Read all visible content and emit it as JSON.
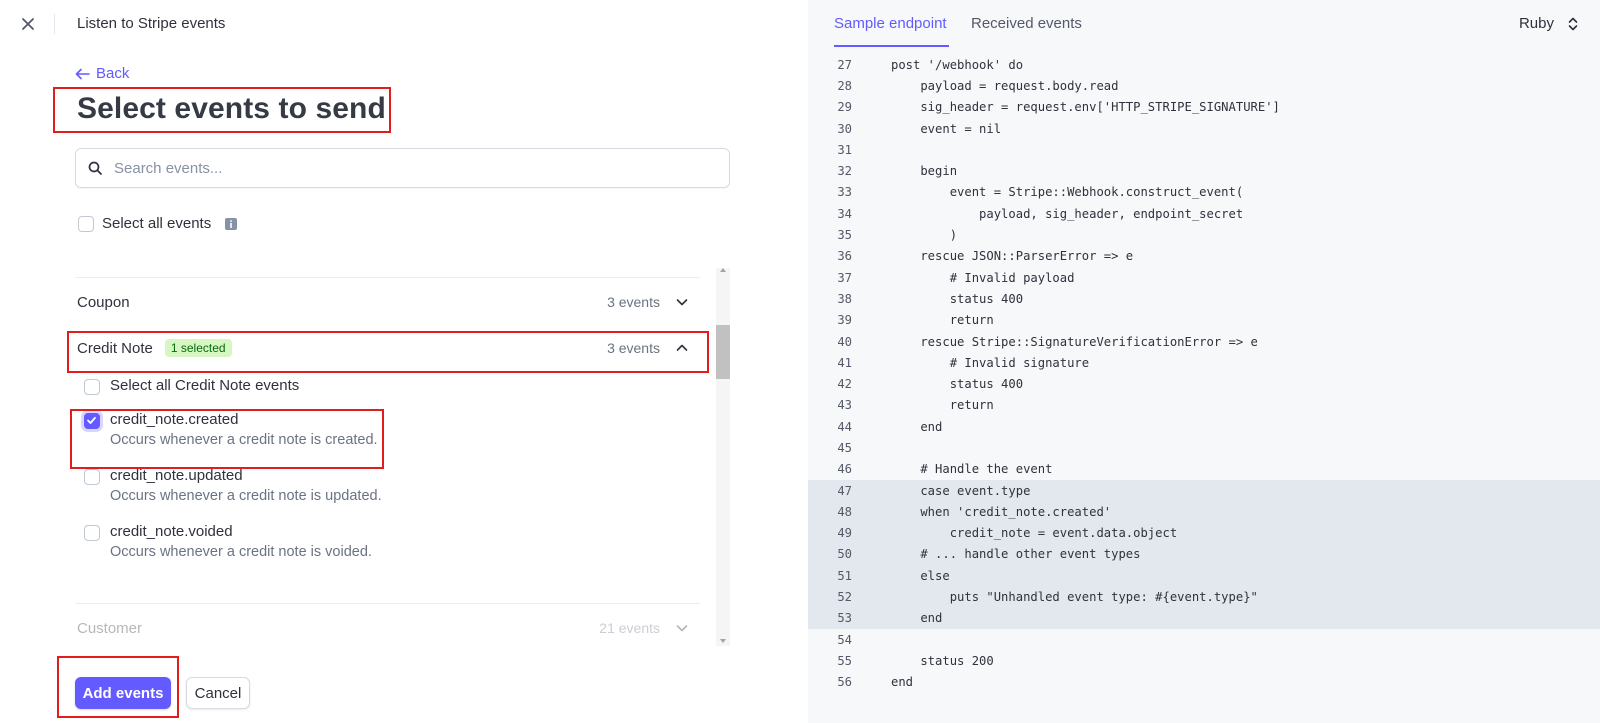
{
  "topbar": {
    "title": "Listen to Stripe events",
    "close_icon": "close-icon"
  },
  "back_label": "Back",
  "page_title": "Select events to send",
  "search": {
    "placeholder": "Search events...",
    "value": ""
  },
  "select_all_label": "Select all events",
  "groups": [
    {
      "name": "Coupon",
      "count": "3 events",
      "expanded": false
    },
    {
      "name": "Credit Note",
      "badge": "1 selected",
      "count": "3 events",
      "expanded": true
    },
    {
      "name": "Customer",
      "count": "21 events",
      "expanded": false
    }
  ],
  "credit_note": {
    "select_all_label": "Select all Credit Note events",
    "events": [
      {
        "name": "credit_note.created",
        "desc": "Occurs whenever a credit note is created.",
        "checked": true
      },
      {
        "name": "credit_note.updated",
        "desc": "Occurs whenever a credit note is updated.",
        "checked": false
      },
      {
        "name": "credit_note.voided",
        "desc": "Occurs whenever a credit note is voided.",
        "checked": false
      }
    ]
  },
  "buttons": {
    "add": "Add events",
    "cancel": "Cancel"
  },
  "right": {
    "tabs": [
      "Sample endpoint",
      "Received events"
    ],
    "language": "Ruby",
    "accent": "#635bff"
  },
  "code": [
    {
      "n": "27",
      "t": "post '/webhook' do"
    },
    {
      "n": "28",
      "t": "    payload = request.body.read"
    },
    {
      "n": "29",
      "t": "    sig_header = request.env['HTTP_STRIPE_SIGNATURE']"
    },
    {
      "n": "30",
      "t": "    event = nil"
    },
    {
      "n": "31",
      "t": ""
    },
    {
      "n": "32",
      "t": "    begin"
    },
    {
      "n": "33",
      "t": "        event = Stripe::Webhook.construct_event("
    },
    {
      "n": "34",
      "t": "            payload, sig_header, endpoint_secret"
    },
    {
      "n": "35",
      "t": "        )"
    },
    {
      "n": "36",
      "t": "    rescue JSON::ParserError => e"
    },
    {
      "n": "37",
      "t": "        # Invalid payload"
    },
    {
      "n": "38",
      "t": "        status 400"
    },
    {
      "n": "39",
      "t": "        return"
    },
    {
      "n": "40",
      "t": "    rescue Stripe::SignatureVerificationError => e"
    },
    {
      "n": "41",
      "t": "        # Invalid signature"
    },
    {
      "n": "42",
      "t": "        status 400"
    },
    {
      "n": "43",
      "t": "        return"
    },
    {
      "n": "44",
      "t": "    end"
    },
    {
      "n": "45",
      "t": ""
    },
    {
      "n": "46",
      "t": "    # Handle the event"
    },
    {
      "n": "47",
      "t": "    case event.type",
      "hl": true
    },
    {
      "n": "48",
      "t": "    when 'credit_note.created'",
      "hl": true
    },
    {
      "n": "49",
      "t": "        credit_note = event.data.object",
      "hl": true
    },
    {
      "n": "50",
      "t": "    # ... handle other event types",
      "hl": true
    },
    {
      "n": "51",
      "t": "    else",
      "hl": true
    },
    {
      "n": "52",
      "t": "        puts \"Unhandled event type: #{event.type}\"",
      "hl": true
    },
    {
      "n": "53",
      "t": "    end",
      "hl": true
    },
    {
      "n": "54",
      "t": ""
    },
    {
      "n": "55",
      "t": "    status 200"
    },
    {
      "n": "56",
      "t": "end"
    }
  ]
}
